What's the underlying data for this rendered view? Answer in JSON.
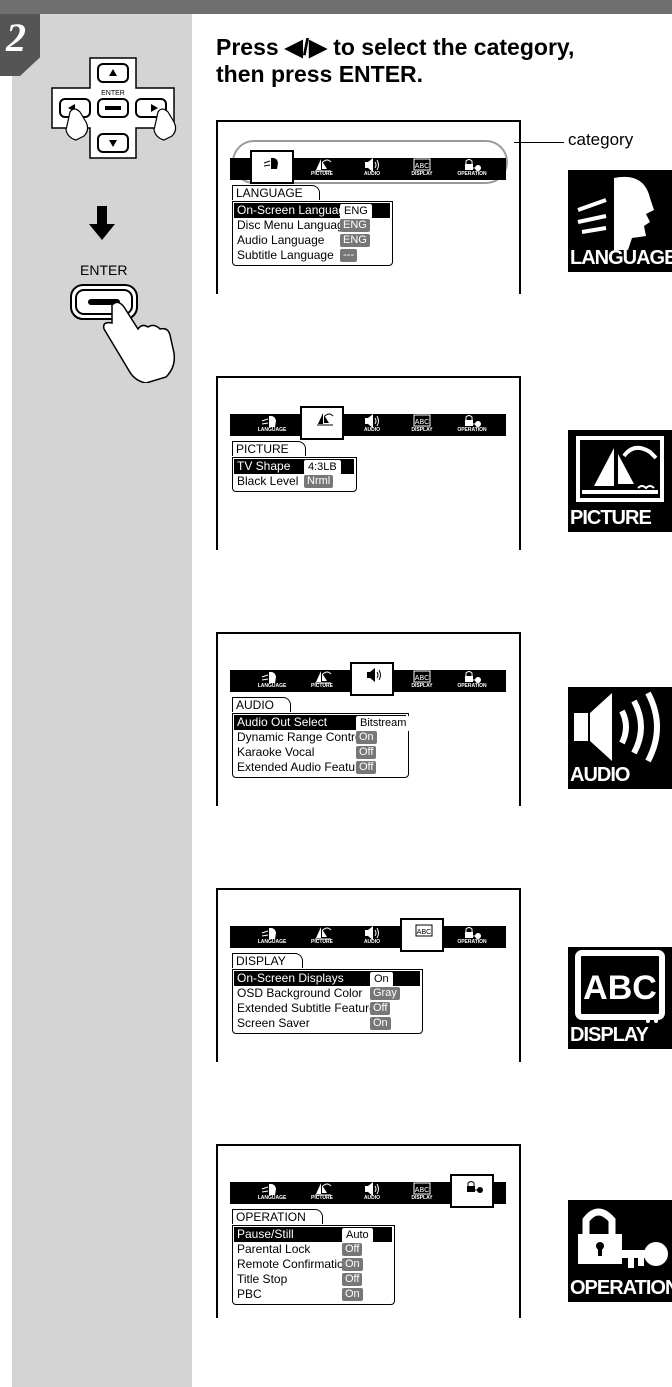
{
  "step_number": "2",
  "heading": {
    "line1": "Press ◀/▶ to select the category,",
    "line2": "then press ENTER."
  },
  "remote": {
    "enter_small_label": "ENTER"
  },
  "enter_label": "ENTER",
  "category_label": "category",
  "tab_labels": [
    "LANGUAGE",
    "PICTURE",
    "AUDIO",
    "DISPLAY",
    "OPERATION"
  ],
  "screens": [
    {
      "menu_title": "LANGUAGE",
      "selected_tab": 0,
      "rows": [
        {
          "label": "On-Screen Language",
          "value": "ENG"
        },
        {
          "label": "Disc Menu Language",
          "value": "ENG"
        },
        {
          "label": "Audio Language",
          "value": "ENG"
        },
        {
          "label": "Subtitle Language",
          "value": "---"
        }
      ]
    },
    {
      "menu_title": "PICTURE",
      "selected_tab": 1,
      "rows": [
        {
          "label": "TV Shape",
          "value": "4:3LB"
        },
        {
          "label": "Black Level",
          "value": "Nrml"
        }
      ]
    },
    {
      "menu_title": "AUDIO",
      "selected_tab": 2,
      "rows": [
        {
          "label": "Audio Out Select",
          "value": "Bitstream"
        },
        {
          "label": "Dynamic Range Control",
          "value": "On"
        },
        {
          "label": "Karaoke Vocal",
          "value": "Off"
        },
        {
          "label": "Extended Audio Feature",
          "value": "Off"
        }
      ]
    },
    {
      "menu_title": "DISPLAY",
      "selected_tab": 3,
      "rows": [
        {
          "label": "On-Screen Displays",
          "value": "On"
        },
        {
          "label": "OSD Background Color",
          "value": "Gray"
        },
        {
          "label": "Extended Subtitle Features",
          "value": "Off"
        },
        {
          "label": "Screen Saver",
          "value": "On"
        }
      ]
    },
    {
      "menu_title": "OPERATION",
      "selected_tab": 4,
      "rows": [
        {
          "label": "Pause/Still",
          "value": "Auto"
        },
        {
          "label": "Parental Lock",
          "value": "Off"
        },
        {
          "label": "Remote Confirmation",
          "value": "On"
        },
        {
          "label": "Title Stop",
          "value": "Off"
        },
        {
          "label": "PBC",
          "value": "On"
        }
      ]
    }
  ],
  "big_icons": [
    {
      "label": "LANGUAGE",
      "icon": "language-icon"
    },
    {
      "label": "PICTURE",
      "icon": "picture-icon"
    },
    {
      "label": "AUDIO",
      "icon": "audio-icon"
    },
    {
      "label": "DISPLAY",
      "icon": "display-icon"
    },
    {
      "label": "OPERATION",
      "icon": "operation-icon"
    }
  ]
}
